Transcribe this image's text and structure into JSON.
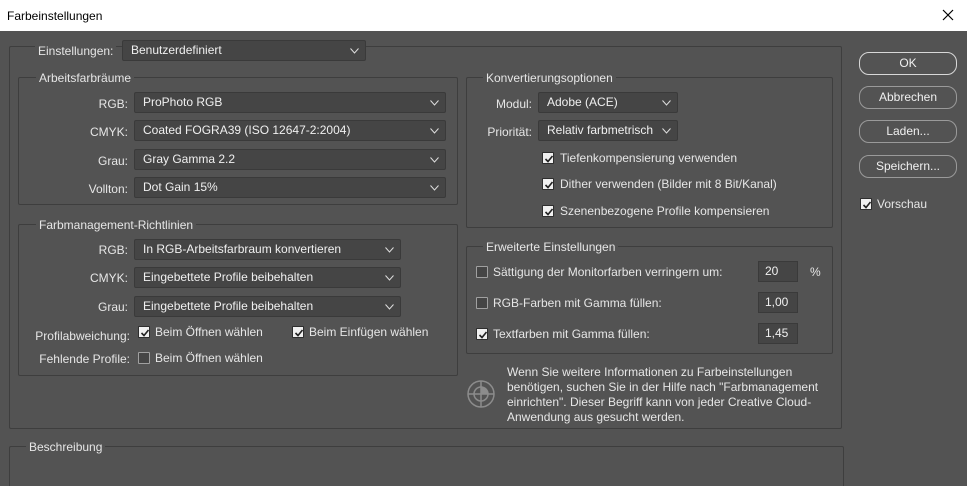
{
  "window": {
    "title": "Farbeinstellungen"
  },
  "settings": {
    "label": "Einstellungen:",
    "value": "Benutzerdefiniert"
  },
  "workspaces": {
    "legend": "Arbeitsfarbräume",
    "rgb": {
      "label": "RGB:",
      "value": "ProPhoto RGB"
    },
    "cmyk": {
      "label": "CMYK:",
      "value": "Coated FOGRA39 (ISO 12647-2:2004)"
    },
    "gray": {
      "label": "Grau:",
      "value": "Gray Gamma 2.2"
    },
    "spot": {
      "label": "Vollton:",
      "value": "Dot Gain 15%"
    }
  },
  "policies": {
    "legend": "Farbmanagement-Richtlinien",
    "rgb": {
      "label": "RGB:",
      "value": "In RGB-Arbeitsfarbraum konvertieren"
    },
    "cmyk": {
      "label": "CMYK:",
      "value": "Eingebettete Profile beibehalten"
    },
    "gray": {
      "label": "Grau:",
      "value": "Eingebettete Profile beibehalten"
    },
    "mismatch": {
      "label": "Profilabweichung:",
      "open_label": "Beim Öffnen wählen",
      "open_checked": true,
      "paste_label": "Beim Einfügen wählen",
      "paste_checked": true
    },
    "missing": {
      "label": "Fehlende Profile:",
      "open_label": "Beim Öffnen wählen",
      "open_checked": false
    }
  },
  "conversion": {
    "legend": "Konvertierungsoptionen",
    "engine": {
      "label": "Modul:",
      "value": "Adobe (ACE)"
    },
    "intent": {
      "label": "Priorität:",
      "value": "Relativ farbmetrisch"
    },
    "bpc": {
      "label": "Tiefenkompensierung verwenden",
      "checked": true
    },
    "dither": {
      "label": "Dither verwenden (Bilder mit 8 Bit/Kanal)",
      "checked": true
    },
    "scene": {
      "label": "Szenenbezogene Profile kompensieren",
      "checked": true
    }
  },
  "advanced": {
    "legend": "Erweiterte Einstellungen",
    "desaturate": {
      "label": "Sättigung der Monitorfarben verringern um:",
      "checked": false,
      "value": "20",
      "unit": "%"
    },
    "blend_rgb": {
      "label": "RGB-Farben mit Gamma füllen:",
      "checked": false,
      "value": "1,00"
    },
    "blend_text": {
      "label": "Textfarben mit Gamma füllen:",
      "checked": true,
      "value": "1,45"
    }
  },
  "info": {
    "lines": [
      "Wenn Sie weitere Informationen zu Farbeinstellungen",
      "benötigen, suchen Sie in der Hilfe nach \"Farbmanagement",
      "einrichten\". Dieser Begriff kann von jeder Creative Cloud-",
      "Anwendung aus gesucht werden."
    ]
  },
  "description": {
    "legend": "Beschreibung"
  },
  "buttons": {
    "ok": "OK",
    "cancel": "Abbrechen",
    "load": "Laden...",
    "save": "Speichern..."
  },
  "preview": {
    "label": "Vorschau",
    "checked": true
  },
  "colors": {
    "dialog_bg": "#535353",
    "field_bg": "#454545",
    "text": "#e6e6e6",
    "titlebar_bg": "#ffffff"
  },
  "icons": {
    "dropdown": "chevron-down-icon",
    "close": "close-icon",
    "checkbox": "checkmark-icon",
    "info": "color-management-icon"
  }
}
